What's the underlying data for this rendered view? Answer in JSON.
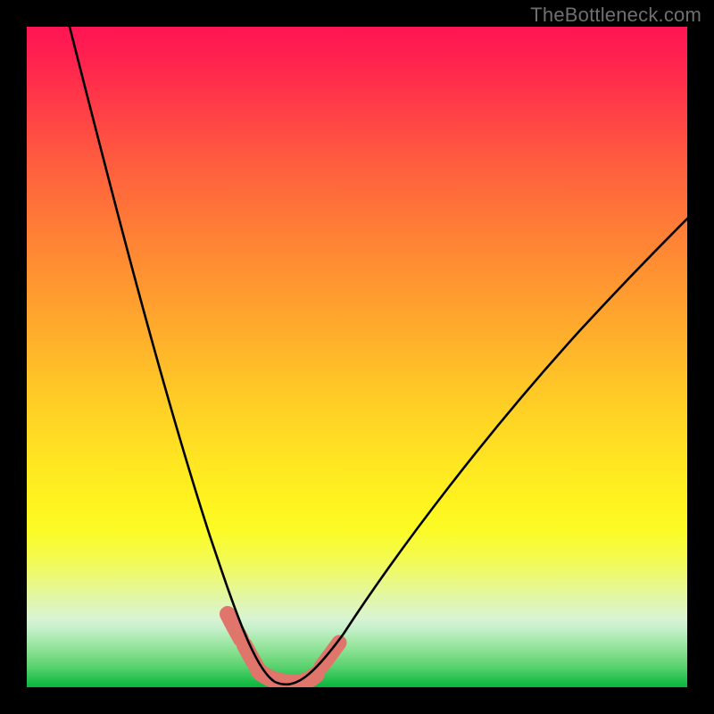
{
  "watermark": "TheBottleneck.com",
  "chart_data": {
    "type": "line",
    "title": "",
    "xlabel": "",
    "ylabel": "",
    "xlim": [
      0,
      100
    ],
    "ylim": [
      0,
      100
    ],
    "grid": false,
    "legend": false,
    "series": [
      {
        "name": "bottleneck-curve",
        "x": [
          6,
          10,
          15,
          20,
          24,
          27,
          30,
          32,
          34,
          36,
          39,
          42,
          45,
          50,
          60,
          70,
          80,
          90,
          100
        ],
        "y": [
          100,
          82,
          62,
          44,
          30,
          20,
          12,
          6,
          2,
          0,
          0,
          1,
          3,
          8,
          20,
          33,
          46,
          58,
          68
        ]
      }
    ],
    "annotations": [
      {
        "name": "valley-marker",
        "type": "rounded-band",
        "x_range": [
          31,
          43
        ],
        "y_range": [
          0,
          9
        ],
        "color": "#e0766b"
      }
    ],
    "background_gradient": {
      "type": "vertical",
      "stops": [
        {
          "pos": 0.0,
          "color": "#ff1553"
        },
        {
          "pos": 0.3,
          "color": "#ff8235"
        },
        {
          "pos": 0.6,
          "color": "#ffdb24"
        },
        {
          "pos": 0.8,
          "color": "#f2fa58"
        },
        {
          "pos": 0.92,
          "color": "#b6ecb6"
        },
        {
          "pos": 1.0,
          "color": "#0bb63e"
        }
      ]
    }
  }
}
